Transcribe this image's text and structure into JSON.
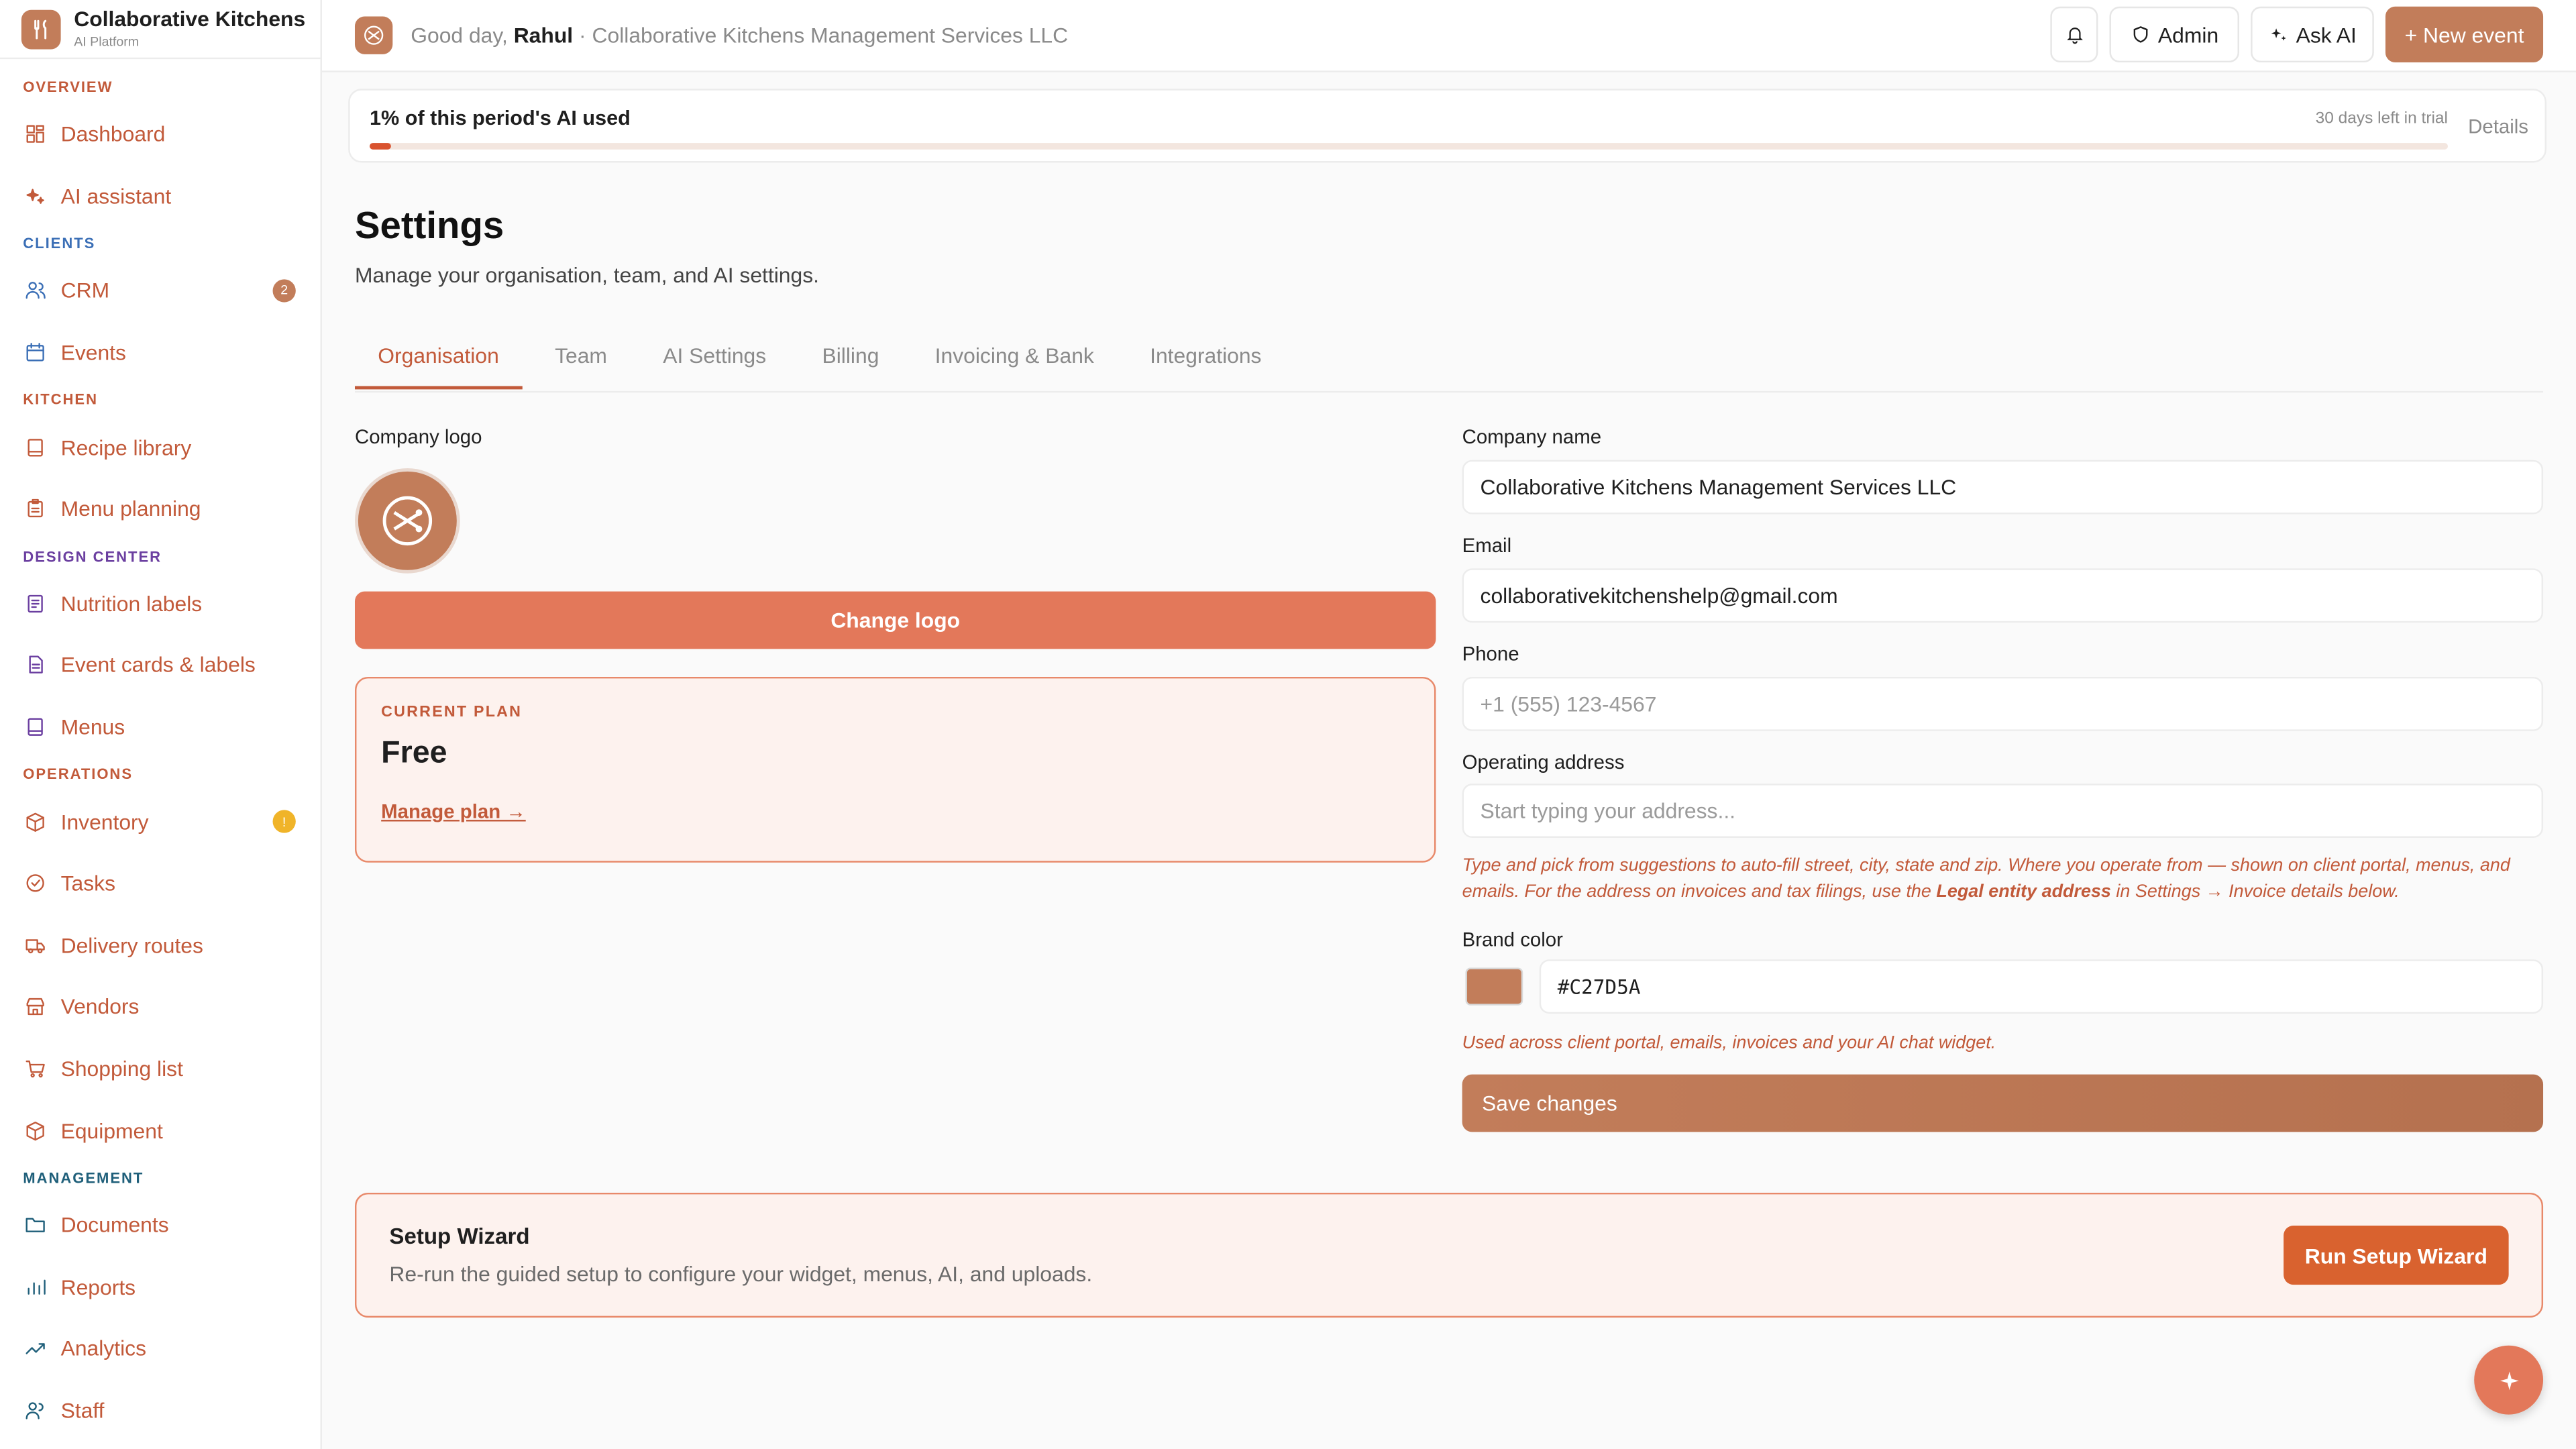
{
  "brand": {
    "name": "Collaborative Kitchens",
    "subtitle": "AI Platform",
    "color": "#c27d5a"
  },
  "sidebar": {
    "sections": [
      {
        "title": "OVERVIEW",
        "color": "#c25a3a",
        "items": [
          {
            "label": "Dashboard",
            "icon": "dashboard-icon"
          },
          {
            "label": "AI assistant",
            "icon": "sparkle-icon"
          }
        ]
      },
      {
        "title": "CLIENTS",
        "color": "#3b6fb6",
        "items": [
          {
            "label": "CRM",
            "icon": "users-icon",
            "badge": "2",
            "badge_color": "#c27d5a"
          },
          {
            "label": "Events",
            "icon": "calendar-icon"
          }
        ]
      },
      {
        "title": "KITCHEN",
        "color": "#c25a3a",
        "items": [
          {
            "label": "Recipe library",
            "icon": "book-icon"
          },
          {
            "label": "Menu planning",
            "icon": "clipboard-icon"
          }
        ]
      },
      {
        "title": "DESIGN CENTER",
        "color": "#6b3fa0",
        "items": [
          {
            "label": "Nutrition labels",
            "icon": "label-icon"
          },
          {
            "label": "Event cards & labels",
            "icon": "card-icon"
          },
          {
            "label": "Menus",
            "icon": "menu-book-icon"
          }
        ]
      },
      {
        "title": "OPERATIONS",
        "color": "#c25a3a",
        "items": [
          {
            "label": "Inventory",
            "icon": "box-icon",
            "badge": "!",
            "badge_color": "#f0b429"
          },
          {
            "label": "Tasks",
            "icon": "check-circle-icon"
          },
          {
            "label": "Delivery routes",
            "icon": "truck-icon"
          },
          {
            "label": "Vendors",
            "icon": "store-icon"
          },
          {
            "label": "Shopping list",
            "icon": "cart-icon"
          },
          {
            "label": "Equipment",
            "icon": "cube-icon"
          }
        ]
      },
      {
        "title": "MANAGEMENT",
        "color": "#1f5f7a",
        "items": [
          {
            "label": "Documents",
            "icon": "folder-icon"
          },
          {
            "label": "Reports",
            "icon": "bar-chart-icon"
          },
          {
            "label": "Analytics",
            "icon": "trend-icon"
          },
          {
            "label": "Staff",
            "icon": "staff-icon"
          }
        ]
      }
    ]
  },
  "header": {
    "greeting_prefix": "Good day,",
    "user": "Rahul",
    "org_suffix": "· Collaborative Kitchens Management Services LLC",
    "admin_label": "Admin",
    "ask_ai_label": "Ask AI",
    "new_event_label": "+ New event"
  },
  "usage": {
    "label": "1% of this period's AI used",
    "percent": 1,
    "trial_text": "30 days left in trial",
    "details_label": "Details"
  },
  "page": {
    "title": "Settings",
    "subtitle": "Manage your organisation, team, and AI settings."
  },
  "tabs": [
    "Organisation",
    "Team",
    "AI Settings",
    "Billing",
    "Invoicing & Bank",
    "Integrations"
  ],
  "active_tab": "Organisation",
  "org": {
    "logo_label": "Company logo",
    "change_logo_label": "Change logo",
    "plan_heading": "CURRENT PLAN",
    "plan_name": "Free",
    "manage_plan_label": "Manage plan →",
    "company_name_label": "Company name",
    "company_name": "Collaborative Kitchens Management Services LLC",
    "email_label": "Email",
    "email": "collaborativekitchenshelp@gmail.com",
    "phone_label": "Phone",
    "phone_placeholder": "+1 (555) 123-4567",
    "address_label": "Operating address",
    "address_placeholder": "Start typing your address...",
    "address_hint_1": "Type and pick from suggestions to auto-fill street, city, state and zip. Where you operate from — shown on client portal, menus, and emails. For the address on invoices and tax filings, use the ",
    "address_hint_bold": "Legal entity address",
    "address_hint_2": " in Settings → Invoice details below.",
    "brand_color_label": "Brand color",
    "brand_color": "#C27D5A",
    "brand_color_hint": "Used across client portal, emails, invoices and your AI chat widget.",
    "save_label": "Save changes"
  },
  "wizard": {
    "title": "Setup Wizard",
    "description": "Re-run the guided setup to configure your widget, menus, AI, and uploads.",
    "button_label": "Run Setup Wizard"
  },
  "fab_icon": "sparkle-icon"
}
